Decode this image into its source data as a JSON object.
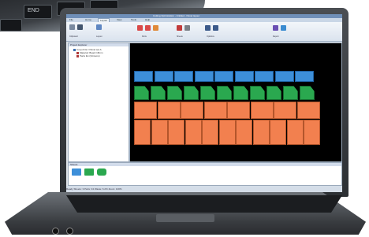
{
  "background": {
    "key_label": "END"
  },
  "app": {
    "title": "Cutting Optimization - Untitled - Panel layout",
    "tabs": [
      "File",
      "Home",
      "Layout",
      "View",
      "Tools",
      "Help"
    ],
    "active_tab": "Layout",
    "ribbon_groups": [
      "Clipboard",
      "Layout",
      "Parts",
      "Sheets",
      "Optimize",
      "Report"
    ],
    "panel_title": "Project Explorer",
    "tree_items": [
      "Cut job list / Panel set A",
      "Material: Board 18mm",
      "Parts list (34 items)"
    ],
    "bottom_panel_title": "Sheets",
    "thumb_labels": [
      "1",
      "2",
      "3"
    ],
    "status_text": "Ready    Sheets: 3    Parts: 34    Waste: 6.2%    Zoom: 100%"
  },
  "colors": {
    "blue_parts": "#3d8fd9",
    "green_parts": "#2aa84f",
    "orange_parts": "#f2804f",
    "canvas": "#000000",
    "ribbon": "#dae3ee"
  },
  "icons": {
    "ribbon": [
      "paste-icon",
      "cut-icon",
      "layout-icon",
      "part-icon",
      "sheet-icon",
      "optimize-icon",
      "report-icon",
      "print-icon"
    ]
  }
}
